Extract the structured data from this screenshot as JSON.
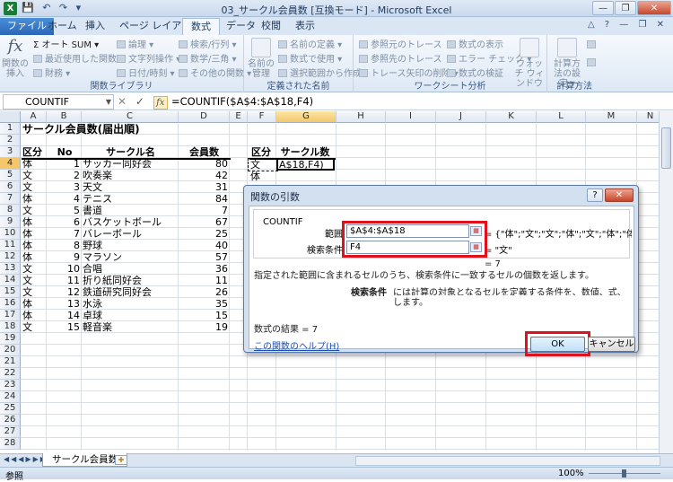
{
  "window": {
    "title": "03_サークル会員数 [互換モード] - Microsoft Excel",
    "app_icon": "X",
    "qat": "💾 ↶ ↷ ▾",
    "controls": [
      "—",
      "❐",
      "✕"
    ],
    "ribbon_controls": "△ ? — ❐ ✕"
  },
  "tabs": [
    "ファイル",
    "ホーム",
    "挿入",
    "ページ レイアウト",
    "数式",
    "データ",
    "校閲",
    "表示"
  ],
  "active_tab": "数式",
  "ribbon": {
    "insert_function": "関数の挿入",
    "autosum": "オート SUM ▾",
    "recent": "最近使用した関数 ▾",
    "financial": "財務 ▾",
    "logical": "論理 ▾",
    "text": "文字列操作 ▾",
    "datetime": "日付/時刻 ▾",
    "lookup": "検索/行列 ▾",
    "math": "数学/三角 ▾",
    "more": "その他の関数 ▾",
    "group_library": "関数ライブラリ",
    "name_manager": "名前の管理",
    "define_name": "名前の定義 ▾",
    "use_in_formula": "数式で使用 ▾",
    "create_from_selection": "選択範囲から作成",
    "group_names": "定義された名前",
    "trace_precedents": "参照元のトレース",
    "trace_dependents": "参照先のトレース",
    "remove_arrows": "トレース矢印の削除 ▾",
    "show_formulas": "数式の表示",
    "error_check": "エラー チェック ▾",
    "evaluate": "数式の検証",
    "watch_window": "ウォッチ ウィンドウ",
    "group_audit": "ワークシート分析",
    "calc_options": "計算方法の設定 ▾",
    "group_calc": "計算方法"
  },
  "formula_bar": {
    "name_box": "COUNTIF",
    "cancel": "✕",
    "enter": "✓",
    "fx": "fx",
    "formula": "=COUNTIF($A$4:$A$18,F4)"
  },
  "columns": [
    "A",
    "B",
    "C",
    "D",
    "E",
    "F",
    "G",
    "H",
    "I",
    "J",
    "K",
    "L",
    "M",
    "N"
  ],
  "rows": [
    "1",
    "2",
    "3",
    "4",
    "5",
    "6",
    "7",
    "8",
    "9",
    "10",
    "11",
    "12",
    "13",
    "14",
    "15",
    "16",
    "17",
    "18",
    "19",
    "20",
    "21",
    "22",
    "23",
    "24",
    "25",
    "26",
    "27",
    "28"
  ],
  "sheet": {
    "title": "サークル会員数(届出順)",
    "headers": [
      "区分",
      "No",
      "サークル名",
      "会員数"
    ],
    "data": [
      [
        "体",
        "1",
        "サッカー同好会",
        "80"
      ],
      [
        "文",
        "2",
        "吹奏楽",
        "42"
      ],
      [
        "文",
        "3",
        "天文",
        "31"
      ],
      [
        "体",
        "4",
        "テニス",
        "84"
      ],
      [
        "文",
        "5",
        "書道",
        "7"
      ],
      [
        "体",
        "6",
        "バスケットボール",
        "67"
      ],
      [
        "体",
        "7",
        "バレーボール",
        "25"
      ],
      [
        "体",
        "8",
        "野球",
        "40"
      ],
      [
        "体",
        "9",
        "マラソン",
        "57"
      ],
      [
        "文",
        "10",
        "合唱",
        "36"
      ],
      [
        "文",
        "11",
        "折り紙同好会",
        "11"
      ],
      [
        "文",
        "12",
        "鉄道研究同好会",
        "26"
      ],
      [
        "体",
        "13",
        "水泳",
        "35"
      ],
      [
        "体",
        "14",
        "卓球",
        "15"
      ],
      [
        "文",
        "15",
        "軽音楽",
        "19"
      ]
    ],
    "summary_headers": [
      "区分",
      "サークル数"
    ],
    "summary_f4": "文",
    "summary_g4": "A$18,F4)",
    "summary_f5": "体"
  },
  "sheet_tab": "サークル会員数",
  "status": {
    "mode": "参照",
    "zoom": "100%"
  },
  "dialog": {
    "title": "関数の引数",
    "help_btn": "?",
    "close_btn": "✕",
    "function_name": "COUNTIF",
    "range_label": "範囲",
    "range_value": "$A$4:$A$18",
    "range_result": "= {\"体\";\"文\";\"文\";\"体\";\"文\";\"体\";\"体\";\"体\";\"",
    "criteria_label": "検索条件",
    "criteria_value": "F4",
    "criteria_result": "= \"文\"",
    "eval_result": "= 7",
    "description": "指定された範囲に含まれるセルのうち、検索条件に一致するセルの個数を返します。",
    "arg_name": "検索条件",
    "arg_desc_1": "には計算の対象となるセルを定義する条件を、数値、式、または文字列で指定",
    "arg_desc_2": "します。",
    "formula_result": "数式の結果 = 7",
    "help_link": "この関数のヘルプ(H)",
    "ok": "OK",
    "cancel": "キャンセル"
  }
}
